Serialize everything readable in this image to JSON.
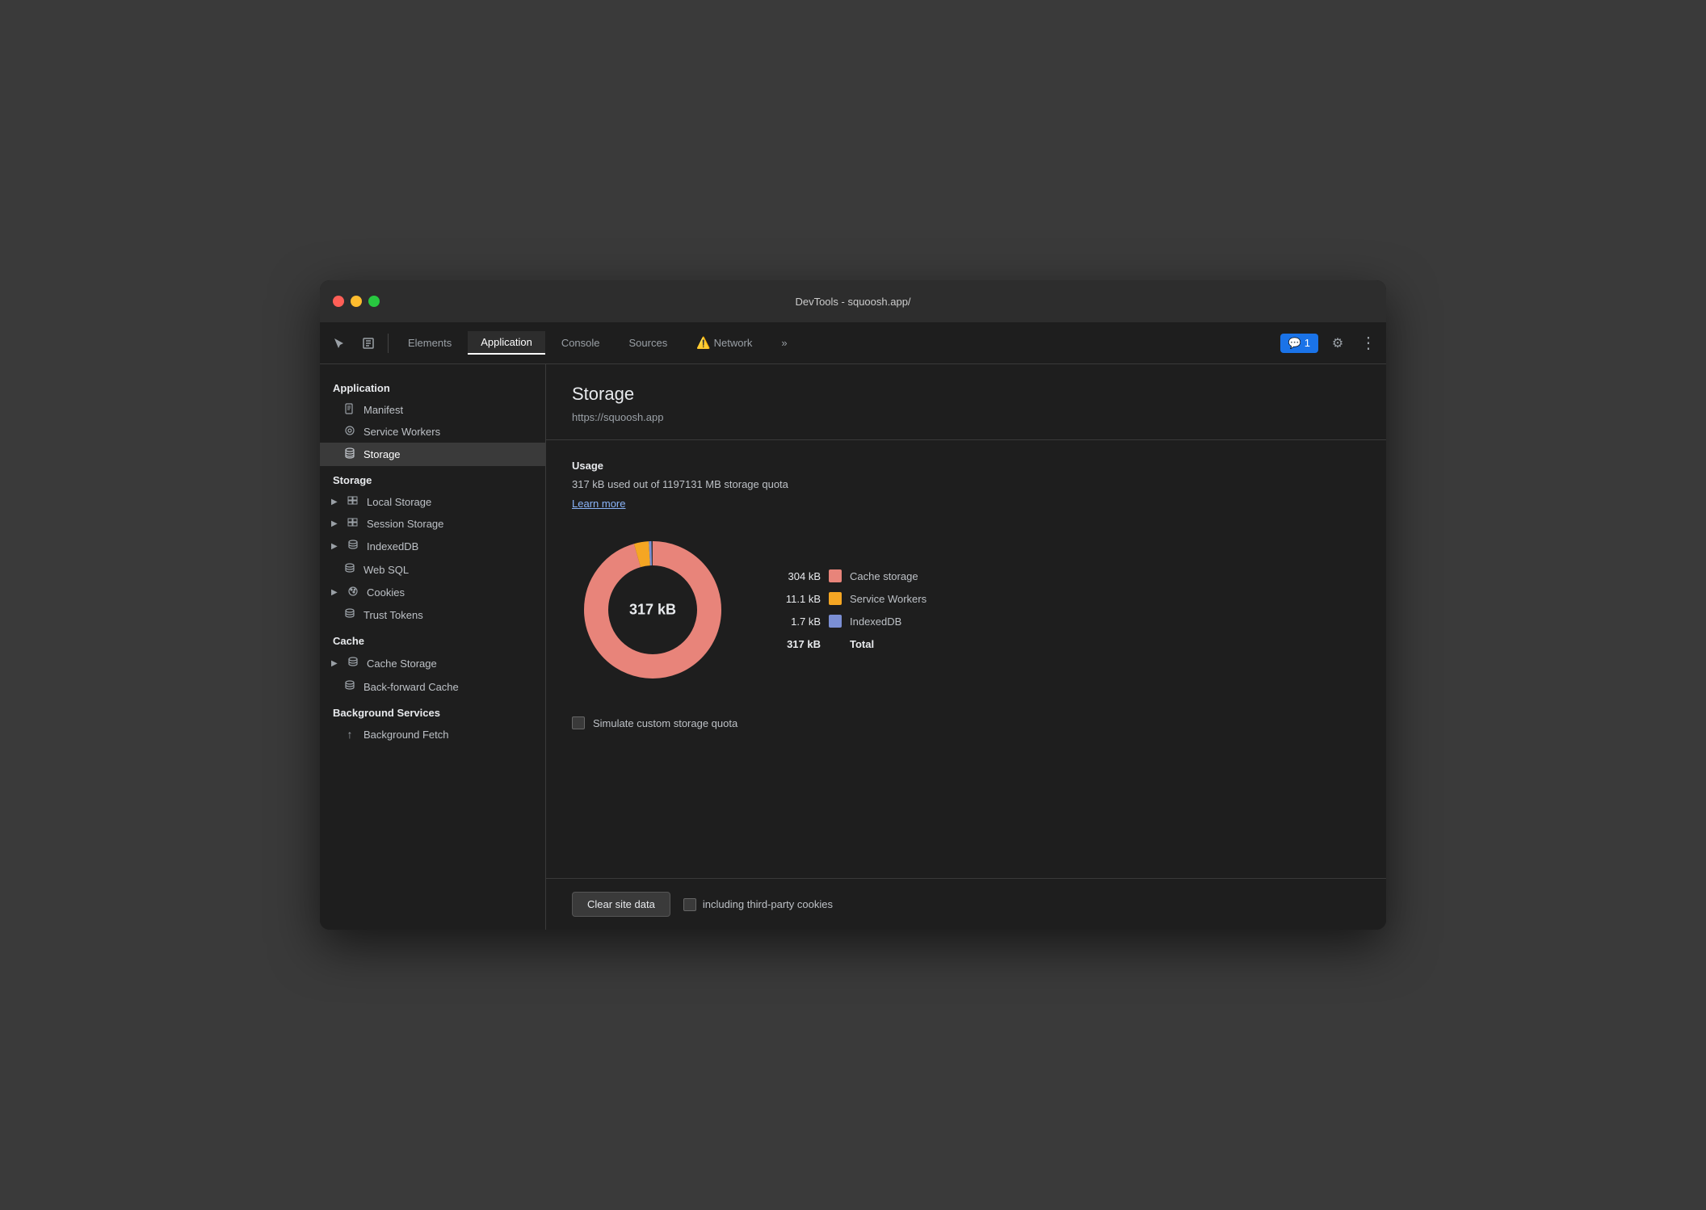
{
  "titlebar": {
    "title": "DevTools - squoosh.app/"
  },
  "toolbar": {
    "tabs": [
      {
        "id": "elements",
        "label": "Elements",
        "active": false,
        "warning": false
      },
      {
        "id": "application",
        "label": "Application",
        "active": true,
        "warning": false
      },
      {
        "id": "console",
        "label": "Console",
        "active": false,
        "warning": false
      },
      {
        "id": "sources",
        "label": "Sources",
        "active": false,
        "warning": false
      },
      {
        "id": "network",
        "label": "Network",
        "active": false,
        "warning": true
      }
    ],
    "more_label": "»",
    "chat_count": "1",
    "settings_icon": "⚙",
    "more_icon": "⋮"
  },
  "sidebar": {
    "sections": [
      {
        "title": "Application",
        "items": [
          {
            "id": "manifest",
            "label": "Manifest",
            "icon": "📄",
            "arrow": false
          },
          {
            "id": "service-workers",
            "label": "Service Workers",
            "icon": "⚙",
            "arrow": false
          },
          {
            "id": "storage",
            "label": "Storage",
            "icon": "🗄",
            "arrow": false,
            "active": true
          }
        ]
      },
      {
        "title": "Storage",
        "items": [
          {
            "id": "local-storage",
            "label": "Local Storage",
            "icon": "▦",
            "arrow": true
          },
          {
            "id": "session-storage",
            "label": "Session Storage",
            "icon": "▦",
            "arrow": true
          },
          {
            "id": "indexeddb",
            "label": "IndexedDB",
            "icon": "🗄",
            "arrow": true
          },
          {
            "id": "web-sql",
            "label": "Web SQL",
            "icon": "🗄",
            "arrow": false
          },
          {
            "id": "cookies",
            "label": "Cookies",
            "icon": "🍪",
            "arrow": true
          },
          {
            "id": "trust-tokens",
            "label": "Trust Tokens",
            "icon": "🗄",
            "arrow": false
          }
        ]
      },
      {
        "title": "Cache",
        "items": [
          {
            "id": "cache-storage",
            "label": "Cache Storage",
            "icon": "🗄",
            "arrow": true
          },
          {
            "id": "back-forward-cache",
            "label": "Back-forward Cache",
            "icon": "🗄",
            "arrow": false
          }
        ]
      },
      {
        "title": "Background Services",
        "items": [
          {
            "id": "background-fetch",
            "label": "Background Fetch",
            "icon": "↑",
            "arrow": false
          }
        ]
      }
    ]
  },
  "content": {
    "title": "Storage",
    "url": "https://squoosh.app",
    "usage": {
      "title": "Usage",
      "text": "317 kB used out of 1197131 MB storage quota",
      "learn_more": "Learn more"
    },
    "chart": {
      "center_label": "317 kB",
      "segments": [
        {
          "label": "Cache storage",
          "value": "304 kB",
          "color": "#e8847a",
          "percent": 95.9
        },
        {
          "label": "Service Workers",
          "value": "11.1 kB",
          "color": "#f5a623",
          "percent": 3.5
        },
        {
          "label": "IndexedDB",
          "value": "1.7 kB",
          "color": "#7b8fd4",
          "percent": 0.6
        }
      ],
      "total_value": "317 kB",
      "total_label": "Total"
    },
    "simulate_checkbox": {
      "label": "Simulate custom storage quota",
      "checked": false
    },
    "footer": {
      "clear_btn": "Clear site data",
      "third_party_label": "including third-party cookies",
      "checked": false
    }
  }
}
